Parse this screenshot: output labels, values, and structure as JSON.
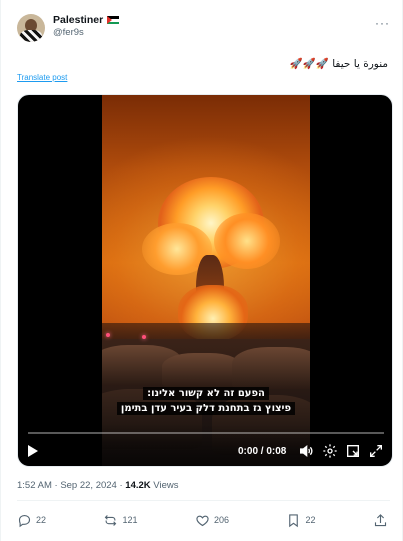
{
  "author": {
    "name": "Palestiner",
    "handle": "@fer9s",
    "flag_icon": "palestine-flag-icon"
  },
  "post": {
    "text": "منورة يا حيفا 🚀🚀🚀",
    "translate_label": "Translate post"
  },
  "video": {
    "subtitle_line1": "הפעם זה לא קשור אלינו:",
    "subtitle_line2": "פיצוץ גז בתחנת דלק בעיר עדן בתימן",
    "time_display": "0:00 / 0:08",
    "progress": 0
  },
  "meta": {
    "time": "1:52 AM",
    "separator": "·",
    "date": "Sep 22, 2024",
    "views_count": "14.2K",
    "views_label": "Views"
  },
  "actions": {
    "replies": "22",
    "reposts": "121",
    "likes": "206",
    "bookmarks": "22"
  },
  "colors": {
    "link": "#1d9bf0",
    "secondary_text": "#536471",
    "primary_text": "#0f1419"
  }
}
